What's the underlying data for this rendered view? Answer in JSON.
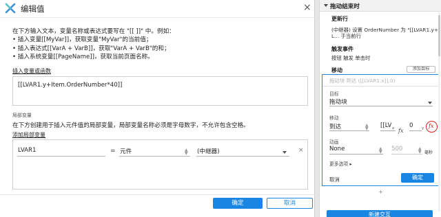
{
  "dialog": {
    "title": "编辑值",
    "close_icon": "×",
    "intro_lines": [
      "在下方输入文本，变量名称或表达式要写在 \"[[ ]]\" 中。例如：",
      "• 插入变量[[MyVar]]，获取变量\"MyVar\"的当前值；",
      "• 插入表达式[[VarA + VarB]]，获取\"VarA + VarB\"的和；",
      "• 插入系统变量[[PageName]]，获取当前页面名称。"
    ],
    "insert_link": "插入变量或函数",
    "expression": "[[LVAR1.y+Item.OrderNumber*40]]",
    "local_vars_heading": "局部变量",
    "local_vars_desc": "在下方创建用于插入元件值的局部变量，局部变量名称必须是字母数字，不允许包含空格。",
    "add_local_link": "添加局部变量",
    "local_var": {
      "name": "LVAR1",
      "eq": "=",
      "type": "元件",
      "target": "(中继器)",
      "delete_icon": "×"
    },
    "ok_label": "确定",
    "cancel_label": "取消"
  },
  "panel": {
    "header": "拖动结束时",
    "update_row_title": "更新行",
    "update_row_desc_1": "(中继器) 设置 OrderNumber 为 \"[[LVAR1.y+",
    "update_row_desc_2": "L... 于当前行",
    "trigger_title": "触发事件",
    "trigger_desc": "按钮 触发 单击时",
    "move_title": "移动",
    "add_target": "添加目标",
    "move": {
      "ghost": "拖动块 到达 ([[LVAR1.x]],0)",
      "target_label": "目标",
      "target_value": "拖动块",
      "move_label": "移动",
      "move_value": "到达",
      "x_value": "[[LV",
      "x_suffix": "x",
      "y_value": "0",
      "y_suffix": "y",
      "fx": "fx",
      "anim_label": "动画",
      "anim_value": "None",
      "duration_value": "500",
      "duration_unit": "毫秒",
      "more_options": "更多选项 ▸",
      "cancel": "取消",
      "confirm": "确定"
    },
    "plus": "+",
    "new_interaction": "新建交互"
  },
  "colors": {
    "accent": "#1a86e4",
    "highlight_circle": "#e02020"
  }
}
